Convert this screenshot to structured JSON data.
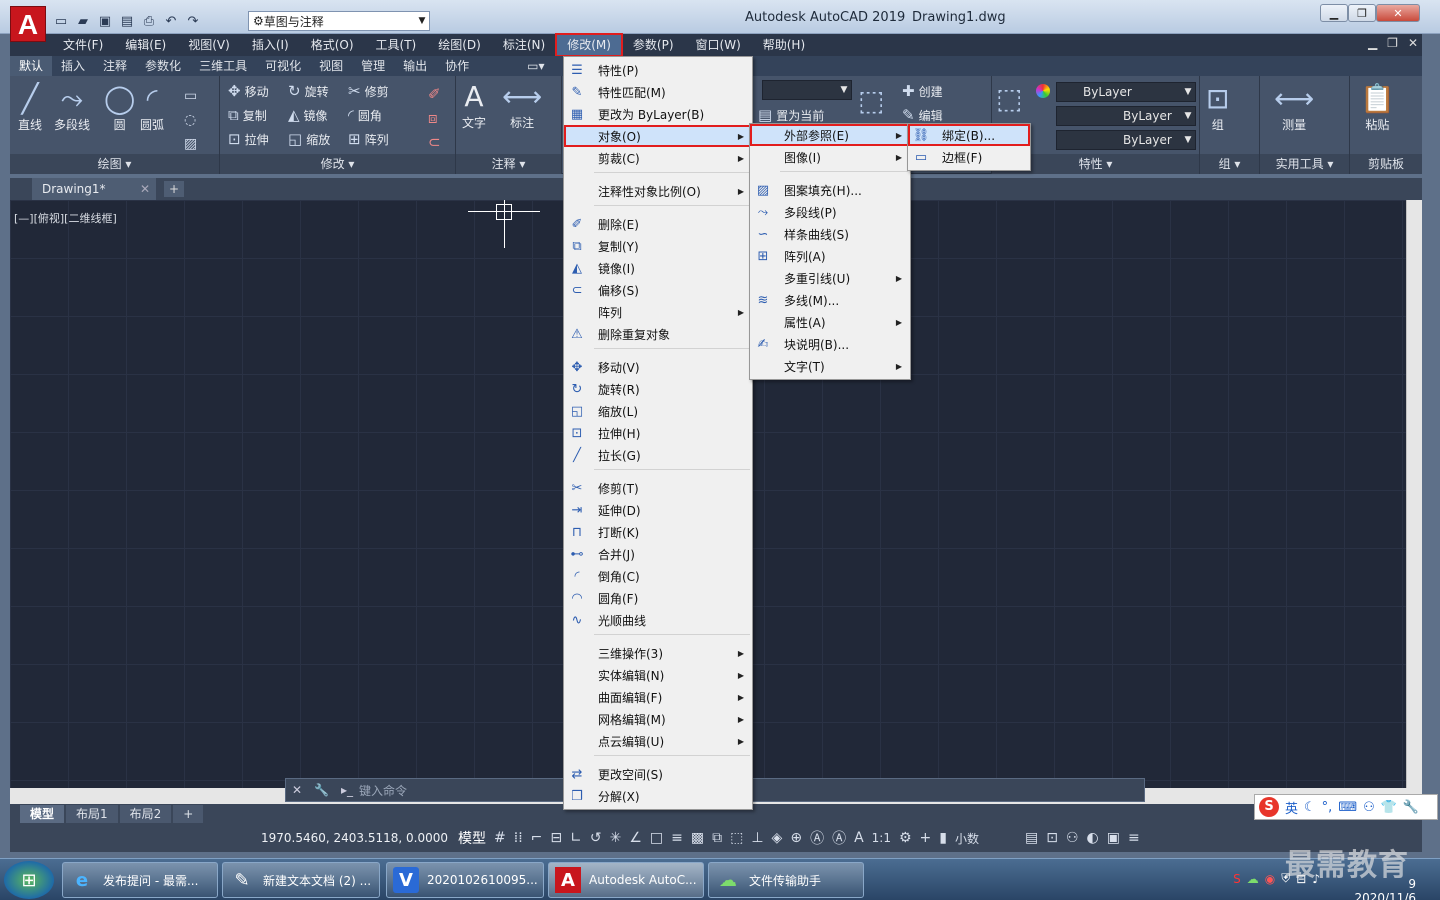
{
  "titlebar": {
    "app_title": "Autodesk AutoCAD 2019",
    "document": "Drawing1.dwg",
    "workspace": "草图与注释"
  },
  "menubar": [
    "文件(F)",
    "编辑(E)",
    "视图(V)",
    "插入(I)",
    "格式(O)",
    "工具(T)",
    "绘图(D)",
    "标注(N)",
    "修改(M)",
    "参数(P)",
    "窗口(W)",
    "帮助(H)"
  ],
  "ribbon_tabs": [
    "默认",
    "插入",
    "注释",
    "参数化",
    "三维工具",
    "可视化",
    "视图",
    "管理",
    "输出",
    "协作"
  ],
  "ribbon": {
    "draw": {
      "panel": "绘图",
      "tools": [
        "直线",
        "多段线",
        "圆",
        "圆弧"
      ]
    },
    "modify": {
      "panel": "修改",
      "tools": [
        "移动",
        "旋转",
        "修剪",
        "复制",
        "镜像",
        "圆角",
        "拉伸",
        "缩放",
        "阵列"
      ]
    },
    "annotate": {
      "panel": "注释",
      "tools": [
        "文字",
        "标注"
      ]
    },
    "layers": {
      "tools": [
        "创建",
        "编辑",
        "置为当前"
      ]
    },
    "properties": {
      "panel": "特性",
      "bylayer": "ByLayer"
    },
    "groups": {
      "panel": "组",
      "tool": "组"
    },
    "utilities": {
      "panel": "实用工具",
      "tool": "测量"
    },
    "clipboard": {
      "panel": "剪贴板",
      "tool": "粘贴"
    }
  },
  "doc_tab": "Drawing1*",
  "viewport_label": "[—][俯视][二维线框]",
  "command_placeholder": "键入命令",
  "layout_tabs": [
    "模型",
    "布局1",
    "布局2"
  ],
  "status": {
    "coords": "1970.5460, 2403.5118, 0.0000",
    "model": "模型",
    "scale": "1:1",
    "units": "小数"
  },
  "modify_menu": [
    {
      "label": "特性(P)",
      "icon": "☰"
    },
    {
      "label": "特性匹配(M)",
      "icon": "✎"
    },
    {
      "label": "更改为 ByLayer(B)",
      "icon": "▦"
    },
    {
      "label": "对象(O)",
      "icon": "",
      "sub": true
    },
    {
      "label": "剪裁(C)",
      "icon": "",
      "sub": true
    },
    {
      "sep": true
    },
    {
      "label": "注释性对象比例(O)",
      "icon": "",
      "sub": true
    },
    {
      "sep": true
    },
    {
      "label": "删除(E)",
      "icon": "✐"
    },
    {
      "label": "复制(Y)",
      "icon": "⧉"
    },
    {
      "label": "镜像(I)",
      "icon": "◭"
    },
    {
      "label": "偏移(S)",
      "icon": "⊂"
    },
    {
      "label": "阵列",
      "icon": "",
      "sub": true
    },
    {
      "label": "删除重复对象",
      "icon": "⚠"
    },
    {
      "sep": true
    },
    {
      "label": "移动(V)",
      "icon": "✥"
    },
    {
      "label": "旋转(R)",
      "icon": "↻"
    },
    {
      "label": "缩放(L)",
      "icon": "◱"
    },
    {
      "label": "拉伸(H)",
      "icon": "⊡"
    },
    {
      "label": "拉长(G)",
      "icon": "╱"
    },
    {
      "sep": true
    },
    {
      "label": "修剪(T)",
      "icon": "✂"
    },
    {
      "label": "延伸(D)",
      "icon": "⇥"
    },
    {
      "label": "打断(K)",
      "icon": "⊓"
    },
    {
      "label": "合并(J)",
      "icon": "⊷"
    },
    {
      "label": "倒角(C)",
      "icon": "◜"
    },
    {
      "label": "圆角(F)",
      "icon": "◠"
    },
    {
      "label": "光顺曲线",
      "icon": "∿"
    },
    {
      "sep": true
    },
    {
      "label": "三维操作(3)",
      "icon": "",
      "sub": true
    },
    {
      "label": "实体编辑(N)",
      "icon": "",
      "sub": true
    },
    {
      "label": "曲面编辑(F)",
      "icon": "",
      "sub": true
    },
    {
      "label": "网格编辑(M)",
      "icon": "",
      "sub": true
    },
    {
      "label": "点云编辑(U)",
      "icon": "",
      "sub": true
    },
    {
      "sep": true
    },
    {
      "label": "更改空间(S)",
      "icon": "⇄"
    },
    {
      "label": "分解(X)",
      "icon": "❒"
    }
  ],
  "object_menu": [
    {
      "label": "外部参照(E)",
      "icon": "",
      "sub": true
    },
    {
      "label": "图像(I)",
      "icon": "",
      "sub": true
    },
    {
      "sep": true
    },
    {
      "label": "图案填充(H)...",
      "icon": "▨"
    },
    {
      "label": "多段线(P)",
      "icon": "⤳"
    },
    {
      "label": "样条曲线(S)",
      "icon": "∽"
    },
    {
      "label": "阵列(A)",
      "icon": "⊞"
    },
    {
      "label": "多重引线(U)",
      "icon": "",
      "sub": true
    },
    {
      "label": "多线(M)...",
      "icon": "≋"
    },
    {
      "label": "属性(A)",
      "icon": "",
      "sub": true
    },
    {
      "label": "块说明(B)...",
      "icon": "✍"
    },
    {
      "label": "文字(T)",
      "icon": "",
      "sub": true
    }
  ],
  "xref_menu": [
    {
      "label": "绑定(B)...",
      "icon": "⛓"
    },
    {
      "label": "边框(F)",
      "icon": "▭"
    }
  ],
  "taskbar": [
    {
      "label": "发布提问 - 最需...",
      "icon": "e"
    },
    {
      "label": "新建文本文档 (2) ...",
      "icon": "✎"
    },
    {
      "label": "2020102610095...",
      "icon": "V"
    },
    {
      "label": "Autodesk AutoC...",
      "icon": "A"
    },
    {
      "label": "文件传输助手",
      "icon": "☁"
    }
  ],
  "tray": {
    "ime": "英",
    "date": "2020/11/6",
    "time": "9"
  },
  "watermark": "最需教育",
  "colors": {
    "accent_red": "#e21d1d",
    "canvas": "#212838",
    "menu_bg": "#f0f0f0"
  }
}
